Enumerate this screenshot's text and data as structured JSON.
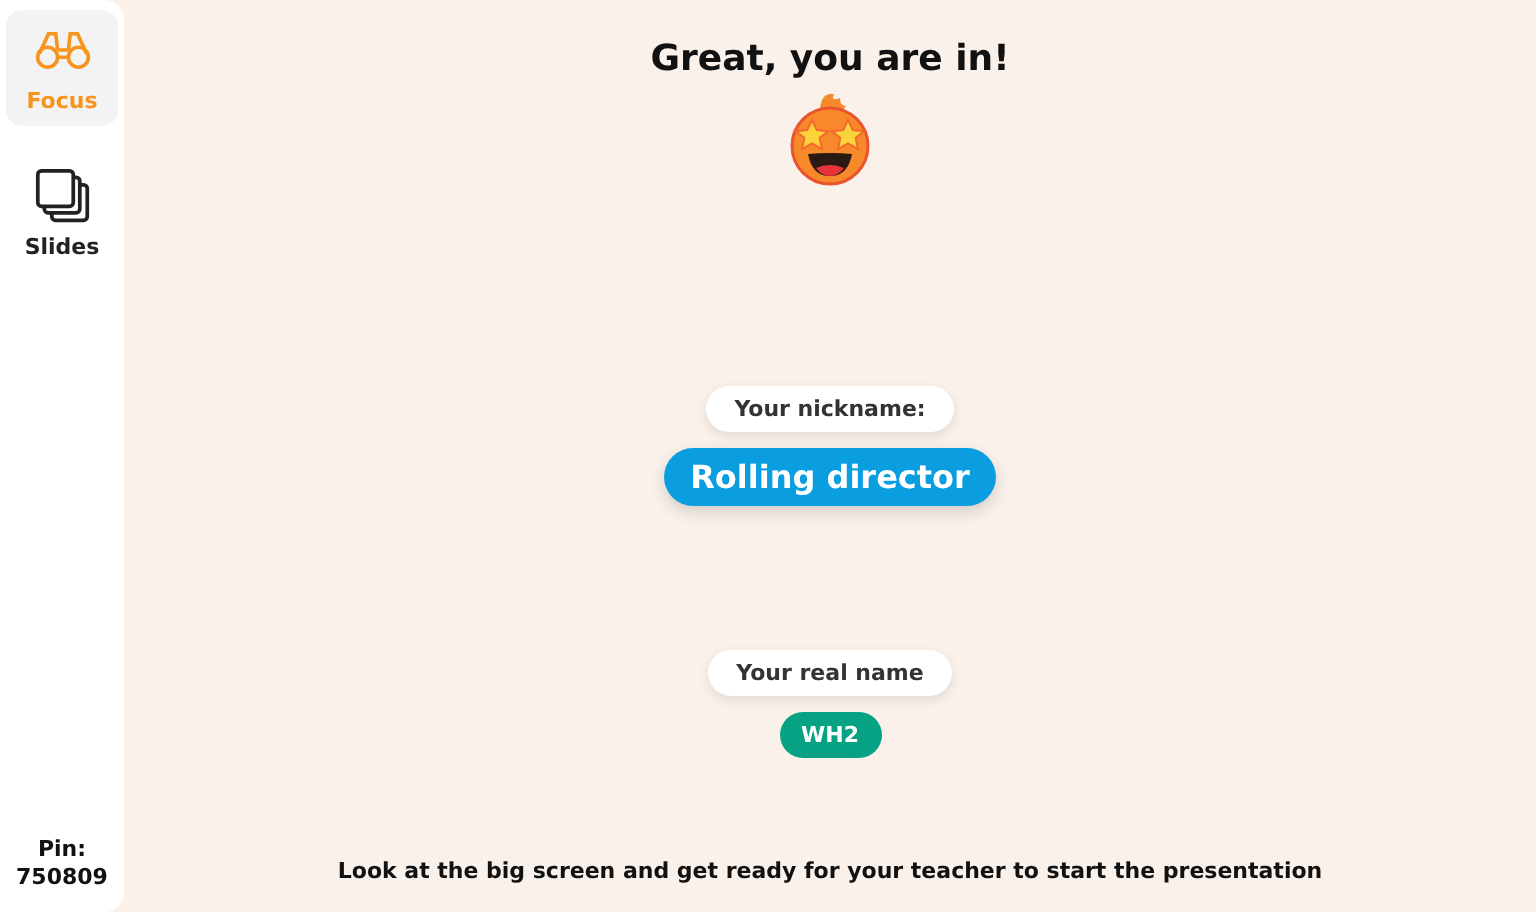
{
  "sidebar": {
    "items": [
      {
        "label": "Focus",
        "selected": true,
        "kind": "binoculars"
      },
      {
        "label": "Slides",
        "selected": false,
        "kind": "slides"
      }
    ],
    "pin_label": "Pin:",
    "pin": "750809"
  },
  "heading": "Great, you are in!",
  "nickname": {
    "label": "Your nickname:",
    "value": "Rolling director"
  },
  "real_name": {
    "label": "Your real name",
    "value": "WH2"
  },
  "footer": "Look at the big screen and get ready for your teacher to start the presentation"
}
